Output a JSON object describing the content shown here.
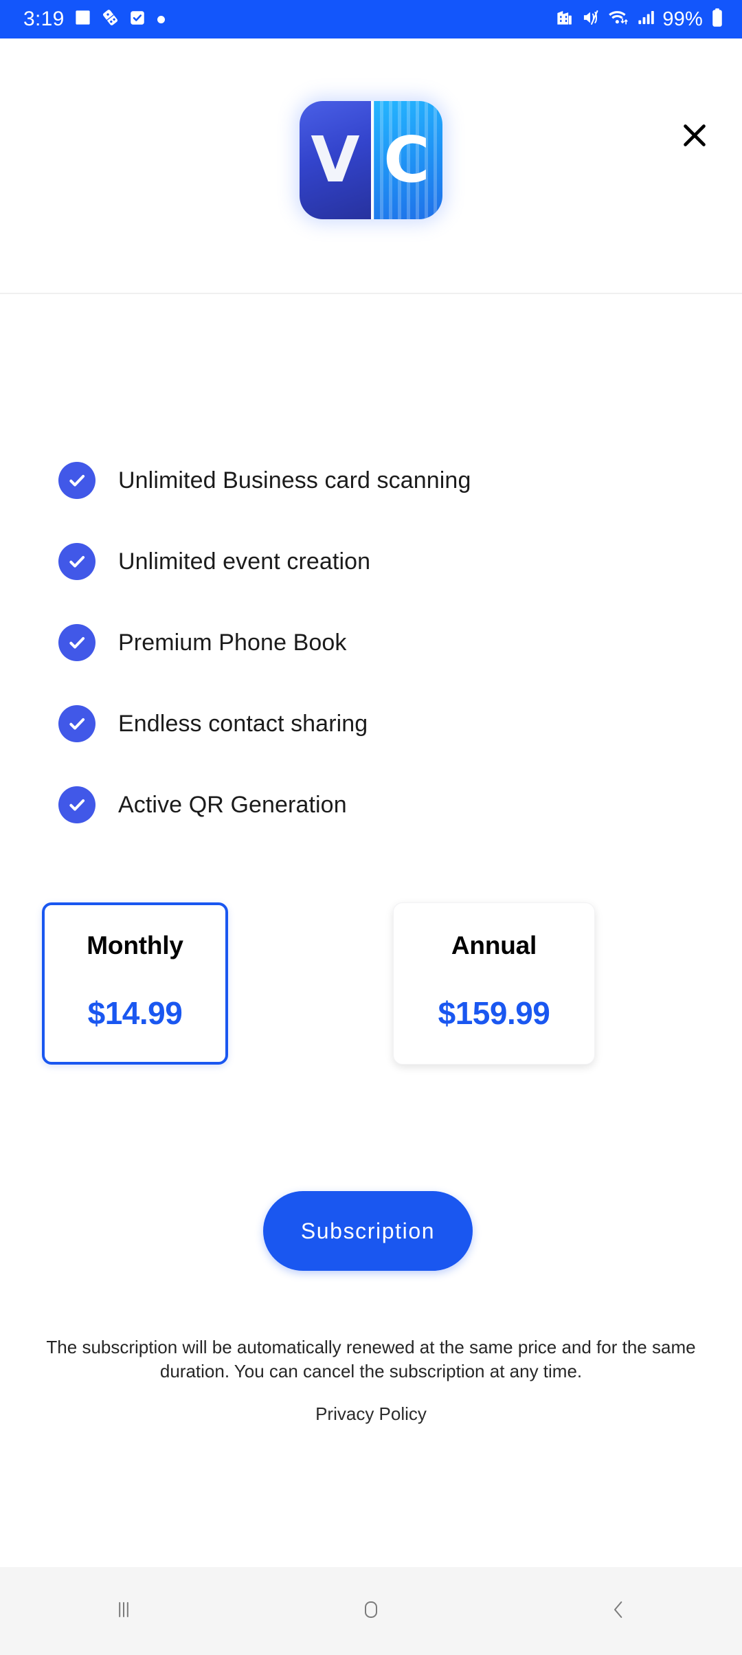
{
  "status_bar": {
    "time": "3:19",
    "battery_percent": "99%",
    "left_icons": [
      "gallery-icon",
      "domino-icon",
      "checkbox-task-icon",
      "dot-indicator-icon"
    ],
    "right_icons": [
      "work-building-icon",
      "mute-vibrate-icon",
      "wifi-data-icon",
      "signal-bars-icon",
      "battery-icon"
    ],
    "background_color": "#1356fb"
  },
  "header": {
    "logo_left_letter": "V",
    "logo_right_letter": "C",
    "close_label": "close"
  },
  "features": {
    "items": [
      {
        "label": "Unlimited Business card scanning"
      },
      {
        "label": "Unlimited event creation"
      },
      {
        "label": "Premium Phone Book"
      },
      {
        "label": "Endless contact sharing"
      },
      {
        "label": "Active QR Generation"
      }
    ]
  },
  "plans": {
    "selected": "Monthly",
    "options": [
      {
        "name": "Monthly",
        "price": "$14.99",
        "selected": true
      },
      {
        "name": "Annual",
        "price": "$159.99",
        "selected": false
      }
    ]
  },
  "cta": {
    "label": "Subscription"
  },
  "legal": {
    "disclaimer": "The subscription will be automatically renewed at the same price and for the same duration. You can cancel the subscription at any time.",
    "privacy_policy": "Privacy Policy"
  },
  "nav_bar": {
    "recents_label": "Recents",
    "home_label": "Home",
    "back_label": "Back"
  },
  "colors": {
    "brand_blue": "#1356fb",
    "accent_blue": "#1a57f0",
    "check_blue": "#4158e8",
    "price_blue": "#1a57f0"
  }
}
